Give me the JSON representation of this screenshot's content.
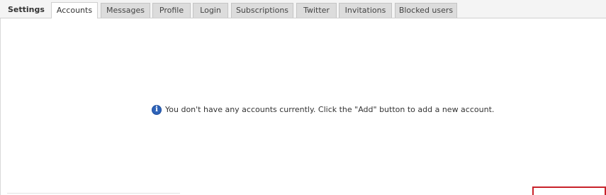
{
  "tabs_header": {
    "title": "Settings"
  },
  "tabs": [
    {
      "label": "Accounts",
      "active": true
    },
    {
      "label": "Messages",
      "active": false
    },
    {
      "label": "Profile",
      "active": false
    },
    {
      "label": "Login",
      "active": false
    },
    {
      "label": "Subscriptions",
      "active": false
    },
    {
      "label": "Twitter",
      "active": false
    },
    {
      "label": "Invitations",
      "active": false
    },
    {
      "label": "Blocked users",
      "active": false
    }
  ],
  "main": {
    "info_icon": "info-icon",
    "info_message": "You don't have any accounts currently. Click the \"Add\" button to add a new account."
  },
  "colors": {
    "tab_bar_bg": "#f4f4f4",
    "inactive_tab_bg": "#dcdcdc",
    "active_tab_bg": "#ffffff",
    "info_icon_blue": "#2e63b8",
    "highlight_red": "#c8222a"
  }
}
